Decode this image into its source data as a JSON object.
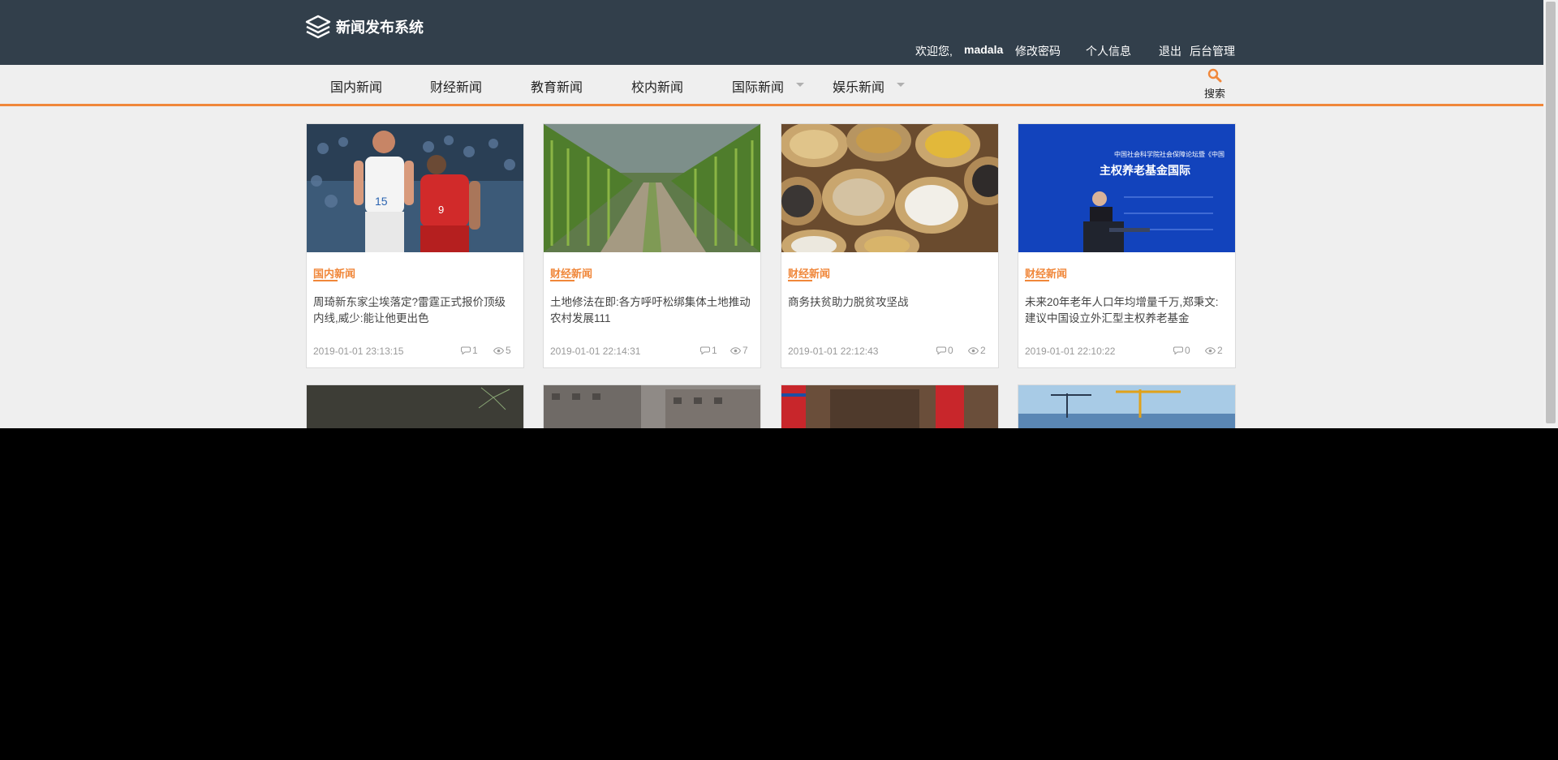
{
  "header": {
    "site_title": "新闻发布系统",
    "welcome": "欢迎您,",
    "username": "madala",
    "links": [
      "修改密码",
      "个人信息",
      "退出",
      "后台管理"
    ]
  },
  "nav": {
    "items": [
      {
        "label": "国内新闻",
        "has_dropdown": false
      },
      {
        "label": "财经新闻",
        "has_dropdown": false
      },
      {
        "label": "教育新闻",
        "has_dropdown": false
      },
      {
        "label": "校内新闻",
        "has_dropdown": false
      },
      {
        "label": "国际新闻",
        "has_dropdown": true
      },
      {
        "label": "娱乐新闻",
        "has_dropdown": true
      }
    ],
    "search_label": "搜索"
  },
  "colors": {
    "header_bg": "#323f4b",
    "accent": "#f0873a",
    "page_bg": "#efefef"
  },
  "articles": [
    {
      "category": "国内新闻",
      "title": "周琦新东家尘埃落定?雷霆正式报价顶级内线,威少:能让他更出色",
      "date": "2019-01-01 23:13:15",
      "comments": "1",
      "views": "5",
      "image": "basketball-photo"
    },
    {
      "category": "财经新闻",
      "title": "土地修法在即:各方呼吁松绑集体土地推动农村发展111",
      "date": "2019-01-01 22:14:31",
      "comments": "1",
      "views": "7",
      "image": "cornfield-road-photo"
    },
    {
      "category": "财经新闻",
      "title": "商务扶贫助力脱贫攻坚战",
      "date": "2019-01-01 22:12:43",
      "comments": "0",
      "views": "2",
      "image": "grain-sacks-photo"
    },
    {
      "category": "财经新闻",
      "title": "未来20年老年人口年均增量千万,郑秉文:建议中国设立外汇型主权养老基金",
      "date": "2019-01-01 22:10:22",
      "comments": "0",
      "views": "2",
      "image": "conference-speaker-photo"
    },
    {
      "image": "fireworks-photo"
    },
    {
      "image": "city-buildings-photo"
    },
    {
      "image": "flags-meeting-photo"
    },
    {
      "image": "construction-cranes-photo"
    }
  ],
  "speaker_banner": {
    "line1": "中国社会科学院社会保障论坛暨《中国",
    "line2": "主权养老基金国际"
  }
}
